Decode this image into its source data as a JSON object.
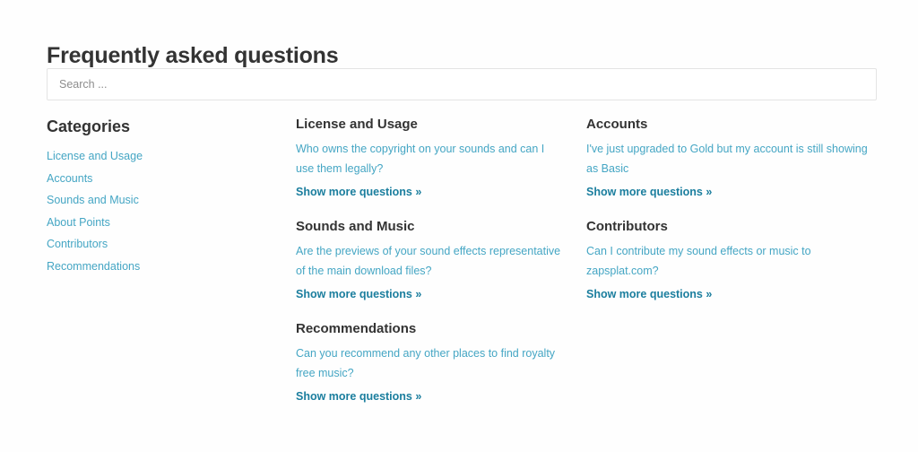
{
  "page": {
    "title": "Frequently asked questions"
  },
  "search": {
    "placeholder": "Search ...",
    "value": ""
  },
  "sidebar": {
    "heading": "Categories",
    "items": [
      {
        "label": "License and Usage"
      },
      {
        "label": "Accounts"
      },
      {
        "label": "Sounds and Music"
      },
      {
        "label": "About Points"
      },
      {
        "label": "Contributors"
      },
      {
        "label": "Recommendations"
      }
    ]
  },
  "middle_column": {
    "blocks": [
      {
        "title": "License and Usage",
        "question": "Who owns the copyright on your sounds and can I use them legally?",
        "more_label": "Show more questions »"
      },
      {
        "title": "Sounds and Music",
        "question": "Are the previews of your sound effects representative of the main download files?",
        "more_label": "Show more questions »"
      },
      {
        "title": "Recommendations",
        "question": "Can you recommend any other places to find royalty free music?",
        "more_label": "Show more questions »"
      }
    ]
  },
  "right_column": {
    "blocks": [
      {
        "title": "Accounts",
        "question": "I've just upgraded to Gold but my account is still showing as Basic",
        "more_label": "Show more questions »"
      },
      {
        "title": "Contributors",
        "question": "Can I contribute my sound effects or music to zapsplat.com?",
        "more_label": "Show more questions »"
      }
    ]
  },
  "colors": {
    "link": "#45a6c4",
    "link_strong": "#1b7e9e",
    "heading": "#333333",
    "border": "#e4e4e4",
    "placeholder": "#8d8d8d",
    "background": "#fefefe"
  }
}
